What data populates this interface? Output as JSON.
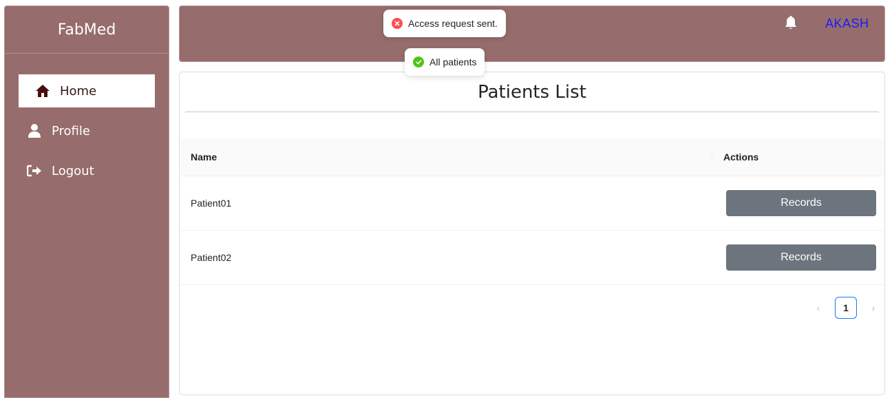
{
  "brand": "FabMed",
  "sidebar": {
    "items": [
      {
        "label": "Home",
        "icon": "home-icon"
      },
      {
        "label": "Profile",
        "icon": "user-icon"
      },
      {
        "label": "Logout",
        "icon": "logout-icon"
      }
    ]
  },
  "header": {
    "username": "AKASH",
    "bell_icon": "bell-icon"
  },
  "toasts": {
    "error": "Access request sent.",
    "success": "All patients"
  },
  "main": {
    "title": "Patients List",
    "table": {
      "columns": [
        "Name",
        "Actions"
      ],
      "rows": [
        {
          "name": "Patient01",
          "action": "Records"
        },
        {
          "name": "Patient02",
          "action": "Records"
        }
      ]
    },
    "pagination": {
      "current_page": "1",
      "prev_icon": "chevron-left-icon",
      "next_icon": "chevron-right-icon"
    }
  },
  "colors": {
    "sidebar_bg": "#966d6c",
    "button_bg": "#6c757d",
    "username": "#1a1aff",
    "error": "#ff4d4f",
    "success": "#52c41a"
  }
}
